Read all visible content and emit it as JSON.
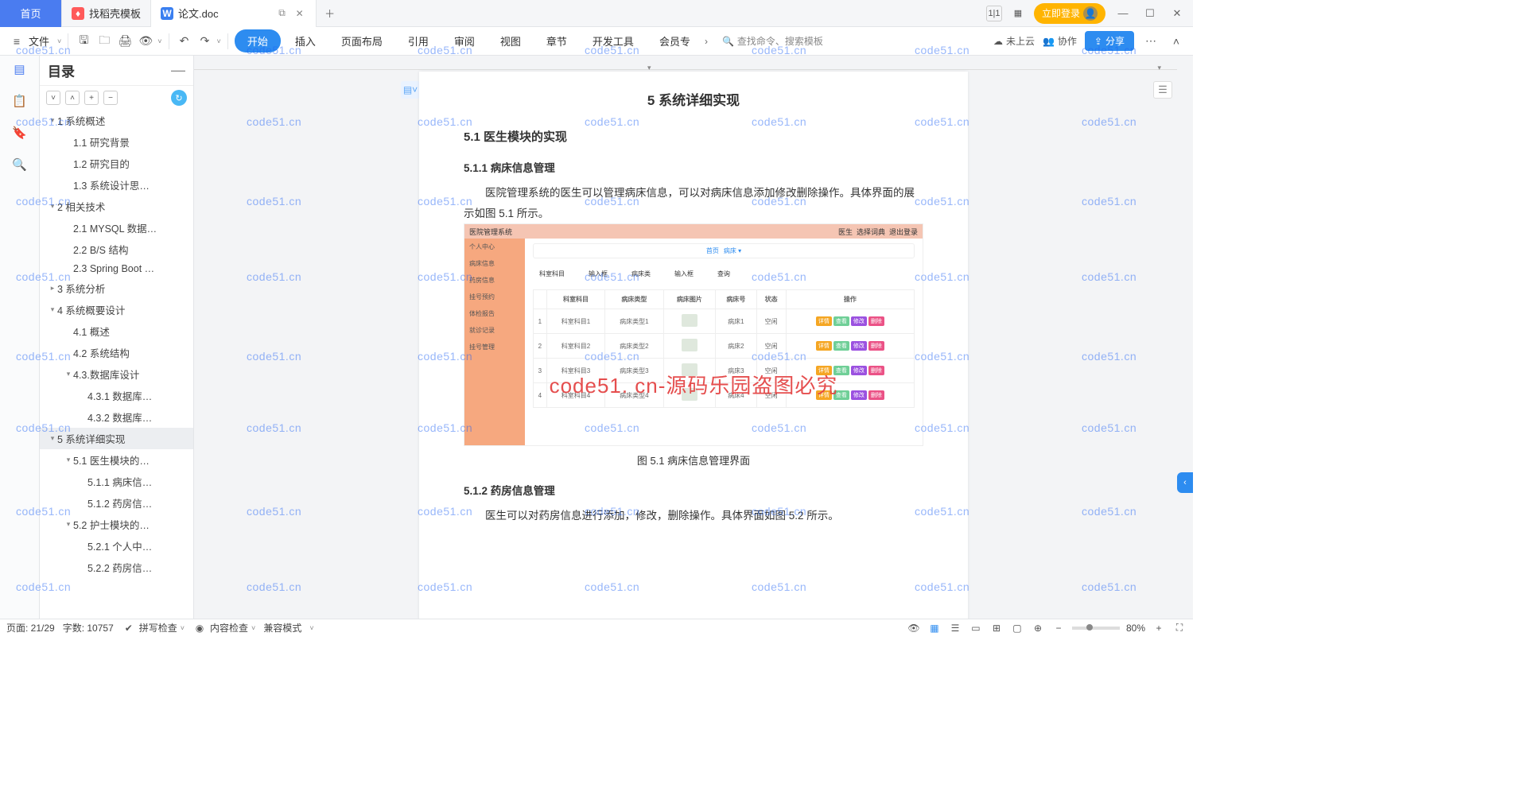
{
  "titlebar": {
    "home": "首页",
    "tab1": "找稻壳模板",
    "tab2": "论文.doc",
    "login": "立即登录"
  },
  "ribbon": {
    "file": "文件",
    "tabs": [
      "开始",
      "插入",
      "页面布局",
      "引用",
      "审阅",
      "视图",
      "章节",
      "开发工具",
      "会员专"
    ],
    "search": "查找命令、搜索模板",
    "cloud": "未上云",
    "coop": "协作",
    "share": "分享"
  },
  "outline": {
    "title": "目录",
    "items": [
      {
        "lv": 1,
        "chev": "▾",
        "text": "1 系统概述"
      },
      {
        "lv": 2,
        "text": "1.1 研究背景"
      },
      {
        "lv": 2,
        "text": "1.2 研究目的"
      },
      {
        "lv": 2,
        "text": "1.3 系统设计思…"
      },
      {
        "lv": 1,
        "chev": "▾",
        "text": "2 相关技术"
      },
      {
        "lv": 2,
        "text": "2.1 MYSQL 数据…"
      },
      {
        "lv": 2,
        "text": "2.2 B/S 结构"
      },
      {
        "lv": 2,
        "text": "2.3 Spring Boot …"
      },
      {
        "lv": 1,
        "chev": "▸",
        "text": "3 系统分析"
      },
      {
        "lv": 1,
        "chev": "▾",
        "text": "4 系统概要设计"
      },
      {
        "lv": 2,
        "text": "4.1 概述"
      },
      {
        "lv": 2,
        "text": "4.2 系统结构"
      },
      {
        "lv": 2,
        "chev": "▾",
        "text": "4.3.数据库设计"
      },
      {
        "lv": 3,
        "text": "4.3.1 数据库…"
      },
      {
        "lv": 3,
        "text": "4.3.2 数据库…"
      },
      {
        "lv": 1,
        "chev": "▾",
        "text": "5 系统详细实现",
        "selected": true
      },
      {
        "lv": 2,
        "chev": "▾",
        "text": "5.1 医生模块的…"
      },
      {
        "lv": 3,
        "text": "5.1.1 病床信…"
      },
      {
        "lv": 3,
        "text": "5.1.2 药房信…"
      },
      {
        "lv": 2,
        "chev": "▾",
        "text": "5.2 护士模块的…"
      },
      {
        "lv": 3,
        "text": "5.2.1 个人中…"
      },
      {
        "lv": 3,
        "text": "5.2.2 药房信…"
      }
    ]
  },
  "doc": {
    "h1": "5 系统详细实现",
    "h2a": "5.1  医生模块的实现",
    "h3a": "5.1.1  病床信息管理",
    "p1": "医院管理系统的医生可以管理病床信息，可以对病床信息添加修改删除操作。具体界面的展示如图 5.1 所示。",
    "cap1": "图 5.1 病床信息管理界面",
    "h3b": "5.1.2  药房信息管理",
    "p2": "医生可以对药房信息进行添加，修改，删除操作。具体界面如图 5.2 所示。"
  },
  "embed": {
    "title": "医院管理系统",
    "navright": [
      "医生",
      "选择词典",
      "退出登录"
    ],
    "side": [
      "个人中心",
      "病床信息",
      "药房信息",
      "挂号预约",
      "体检报告",
      "就诊记录",
      "挂号管理"
    ],
    "chip1": "首页",
    "chip2": "病床 ▾",
    "filters": [
      "科室科目",
      "输入框",
      "病床类",
      "输入框",
      "查询"
    ],
    "th": [
      "",
      "科室科目",
      "病床类型",
      "病床图片",
      "病床号",
      "状态",
      "操作"
    ],
    "rows": [
      [
        "1",
        "科室科目1",
        "病床类型1",
        "",
        "病床1",
        "空闲"
      ],
      [
        "2",
        "科室科目2",
        "病床类型2",
        "",
        "病床2",
        "空闲"
      ],
      [
        "3",
        "科室科目3",
        "病床类型3",
        "",
        "病床3",
        "空闲"
      ],
      [
        "4",
        "科室科目4",
        "病床类型4",
        "",
        "病床4",
        "空闲"
      ]
    ],
    "btns": [
      "详情",
      "查看",
      "修改",
      "删除"
    ]
  },
  "watermark": {
    "small": "code51.cn",
    "big": "code51. cn-源码乐园盗图必究"
  },
  "status": {
    "page": "页面: 21/29",
    "words": "字数: 10757",
    "spell": "拼写检查",
    "content": "内容检查",
    "compat": "兼容模式",
    "zoom": "80%"
  }
}
